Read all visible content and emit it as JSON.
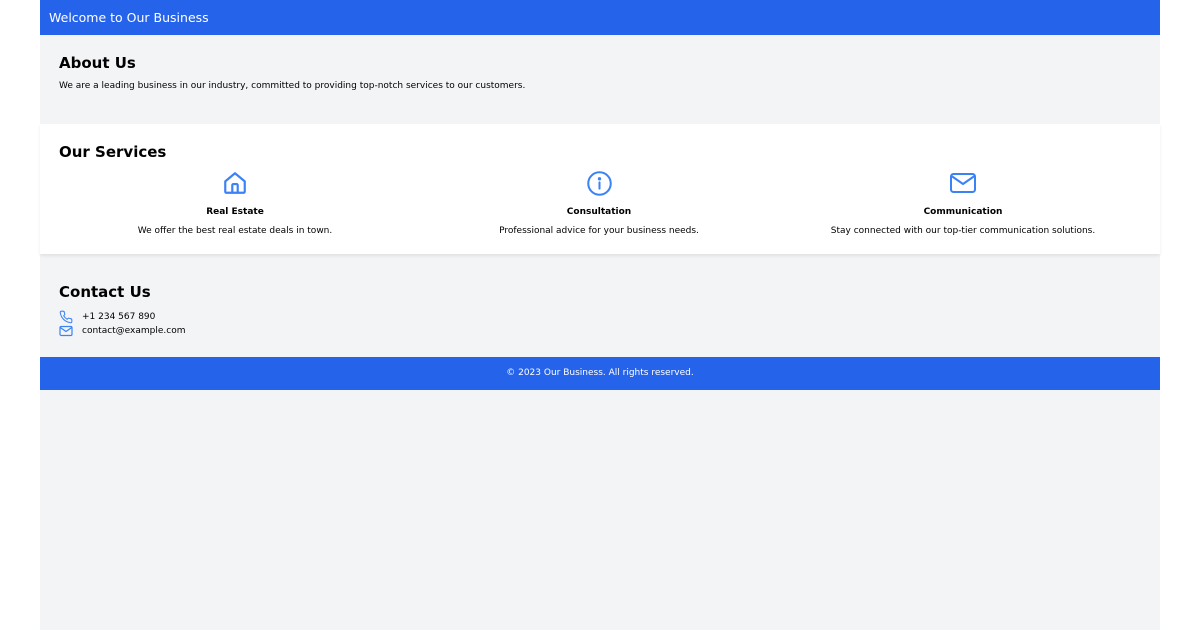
{
  "header": {
    "title": "Welcome to Our Business"
  },
  "about": {
    "heading": "About Us",
    "text": "We are a leading business in our industry, committed to providing top-notch services to our customers."
  },
  "services": {
    "heading": "Our Services",
    "items": [
      {
        "icon": "home-icon",
        "title": "Real Estate",
        "description": "We offer the best real estate deals in town."
      },
      {
        "icon": "info-icon",
        "title": "Consultation",
        "description": "Professional advice for your business needs."
      },
      {
        "icon": "mail-icon",
        "title": "Communication",
        "description": "Stay connected with our top-tier communication solutions."
      }
    ]
  },
  "contact": {
    "heading": "Contact Us",
    "phone": "+1 234 567 890",
    "email": "contact@example.com"
  },
  "footer": {
    "text": "© 2023 Our Business. All rights reserved."
  },
  "colors": {
    "primary": "#2563eb",
    "icon": "#3b82f6",
    "background": "#f3f4f6"
  }
}
